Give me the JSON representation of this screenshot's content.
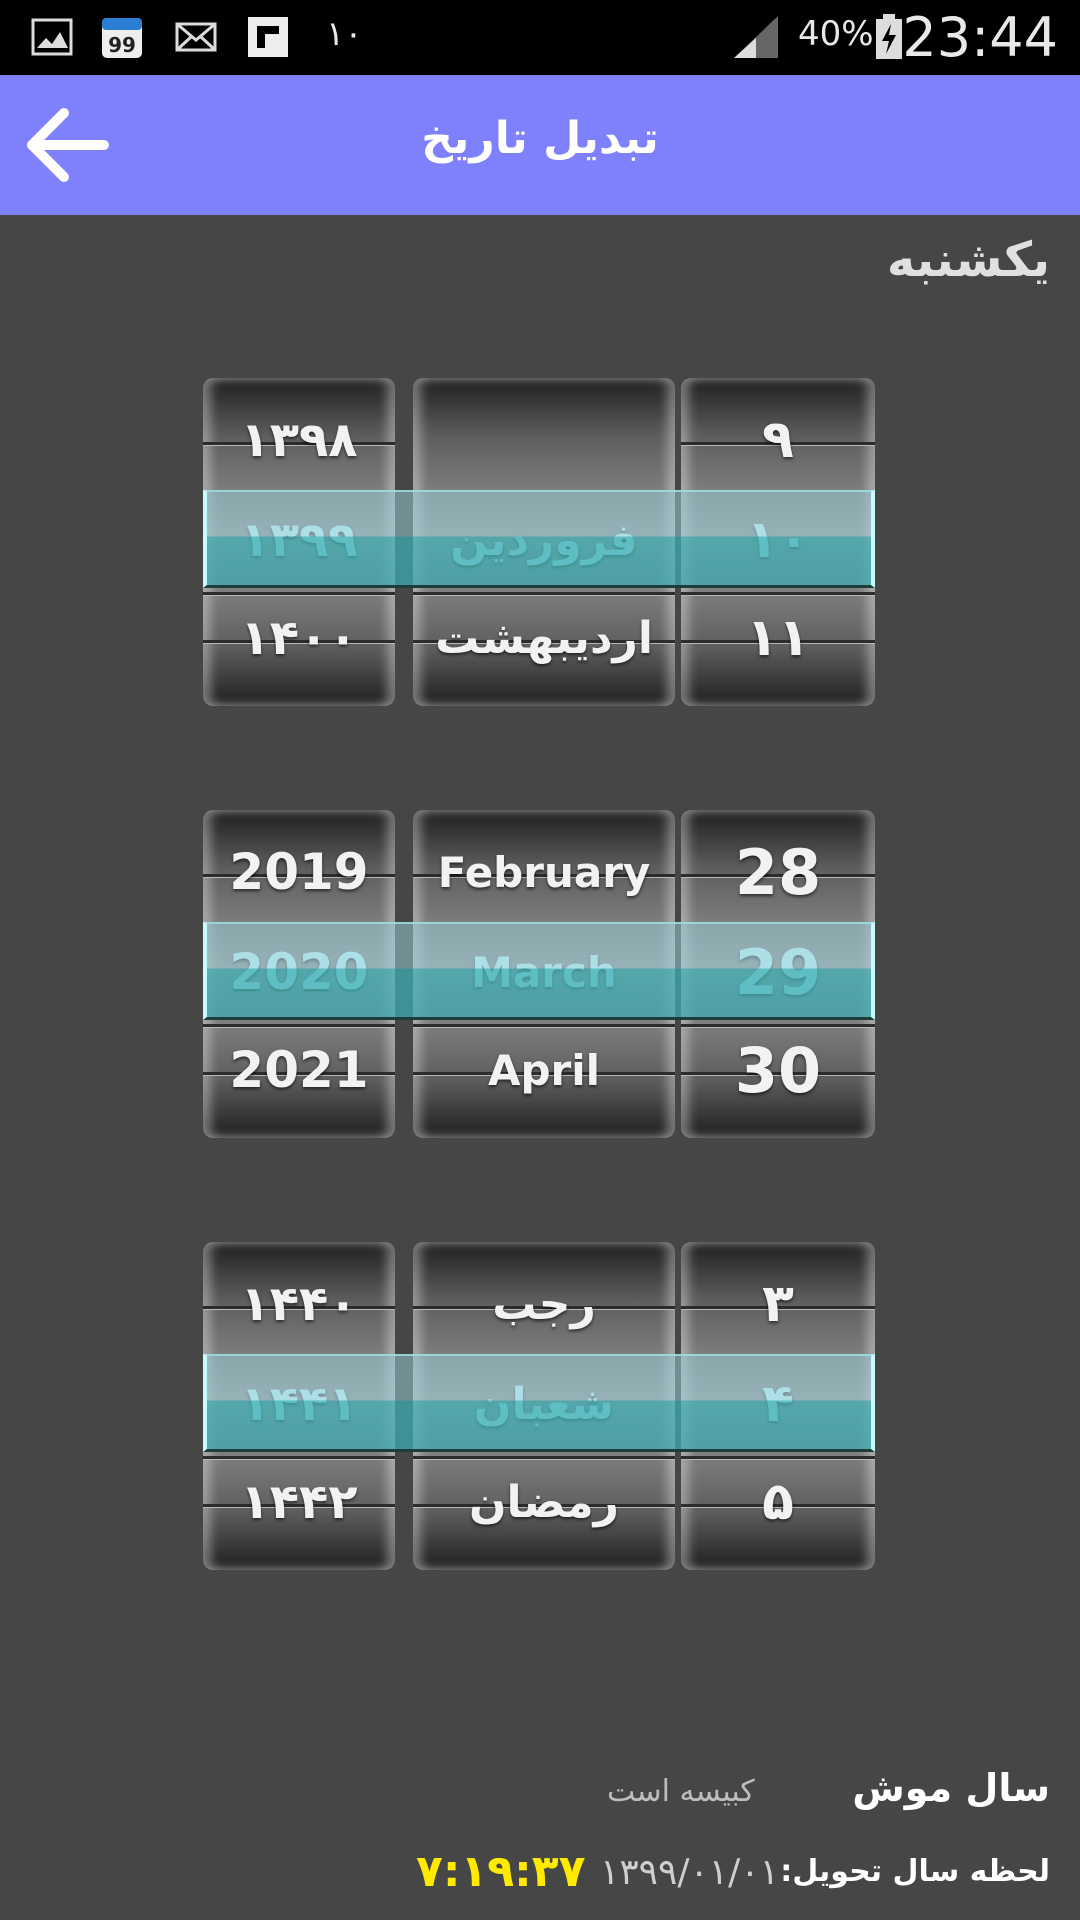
{
  "status_bar": {
    "notification_count": "۱۰",
    "battery": "40%",
    "time": "23:44"
  },
  "app_bar": {
    "title": "تبدیل تاریخ"
  },
  "weekday": "یکشنبه",
  "persian_picker": {
    "years": [
      "۱۳۹۸",
      "۱۳۹۹",
      "۱۴۰۰"
    ],
    "months": [
      "",
      "فروردین",
      "اردیبهشت"
    ],
    "days": [
      "۹",
      "۱۰",
      "۱۱"
    ]
  },
  "gregorian_picker": {
    "years": [
      "2019",
      "2020",
      "2021"
    ],
    "months": [
      "February",
      "March",
      "April"
    ],
    "days": [
      "28",
      "29",
      "30"
    ]
  },
  "hijri_picker": {
    "years": [
      "۱۴۴۰",
      "۱۴۴۱",
      "۱۴۴۲"
    ],
    "months": [
      "رجب",
      "شعبان",
      "رمضان"
    ],
    "days": [
      "۳",
      "۴",
      "۵"
    ]
  },
  "info": {
    "animal_year": "سال موش",
    "leap_status": "کبیسه است",
    "tahvil_label": "لحظه سال تحویل:",
    "tahvil_date": "۱۳۹۹/۰۱/۰۱",
    "tahvil_time": "۷:۱۹:۳۷"
  },
  "colors": {
    "app_bar": "#7f80fb",
    "background": "#464646",
    "selection": "#c8fbff",
    "tahvil_time": "#ffea00"
  }
}
